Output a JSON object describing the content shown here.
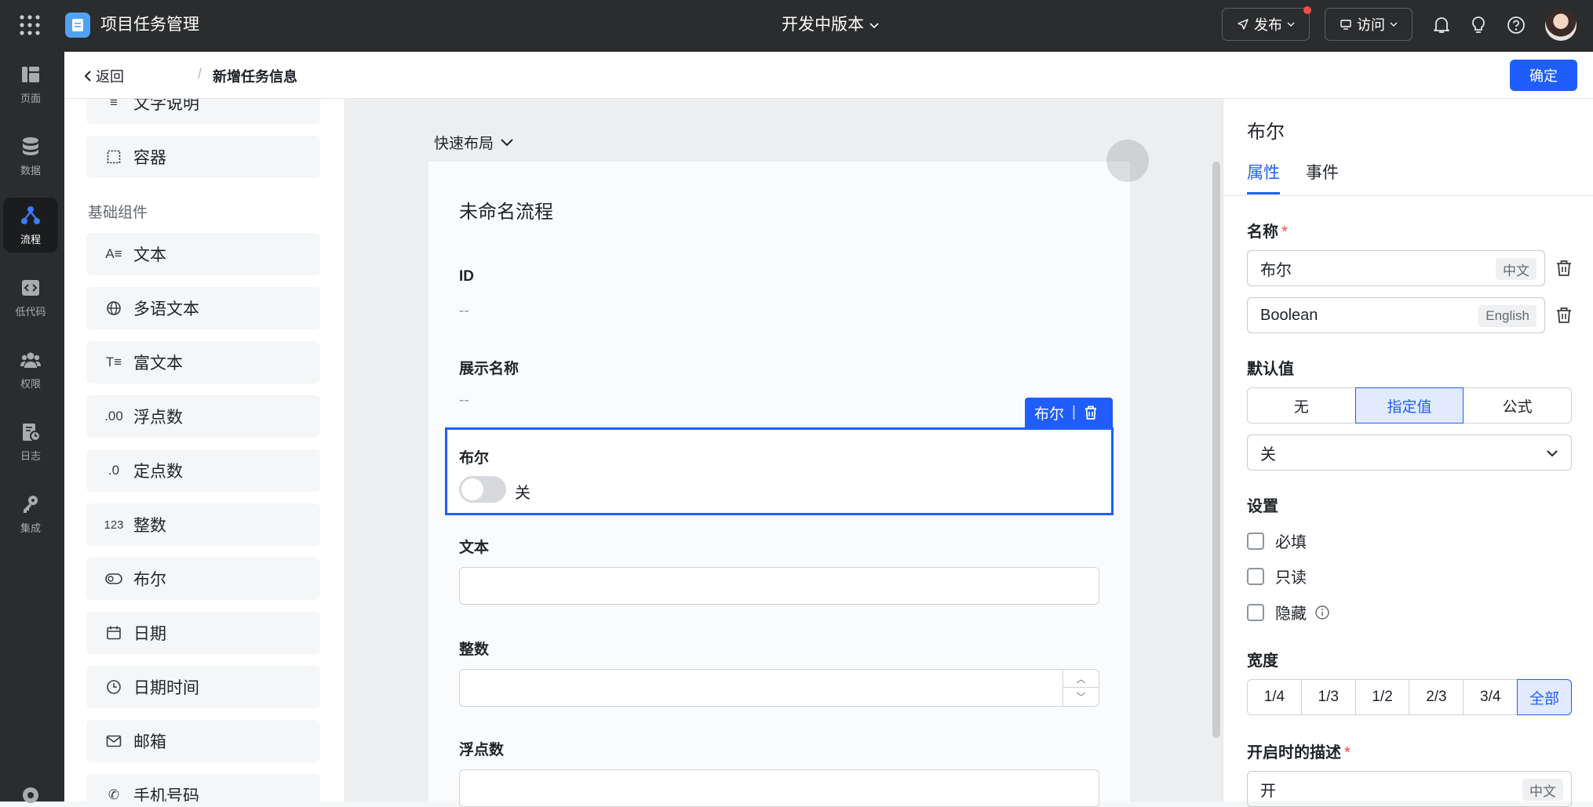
{
  "topbar": {
    "app_title": "项目任务管理",
    "version_label": "开发中版本",
    "publish_label": "发布",
    "visit_label": "访问"
  },
  "rail": {
    "items": [
      {
        "label": "页面",
        "icon": "pages-icon"
      },
      {
        "label": "数据",
        "icon": "database-icon"
      },
      {
        "label": "流程",
        "icon": "flow-icon",
        "active": true
      },
      {
        "label": "低代码",
        "icon": "code-icon"
      },
      {
        "label": "权限",
        "icon": "users-icon"
      },
      {
        "label": "日志",
        "icon": "log-icon"
      },
      {
        "label": "集成",
        "icon": "key-icon"
      }
    ]
  },
  "header": {
    "back_label": "返回",
    "separator": "/",
    "title": "新增任务信息",
    "confirm_label": "确定"
  },
  "components": {
    "top_items": [
      "文字说明",
      "容器"
    ],
    "section_label": "基础组件",
    "items": [
      {
        "label": "文本",
        "icon_text": "A≡"
      },
      {
        "label": "多语文本",
        "icon_text": "🌐"
      },
      {
        "label": "富文本",
        "icon_text": "T≡"
      },
      {
        "label": "浮点数",
        "icon_text": ".00"
      },
      {
        "label": "定点数",
        "icon_text": ".0"
      },
      {
        "label": "整数",
        "icon_text": "123"
      },
      {
        "label": "布尔",
        "icon_text": "⊙"
      },
      {
        "label": "日期",
        "icon_text": "▦"
      },
      {
        "label": "日期时间",
        "icon_text": "◷"
      },
      {
        "label": "邮箱",
        "icon_text": "✉"
      },
      {
        "label": "手机号码",
        "icon_text": "✆"
      }
    ]
  },
  "canvas": {
    "quick_layout": "快速布局",
    "form_title": "未命名流程",
    "id_label": "ID",
    "id_value": "--",
    "display_name_label": "展示名称",
    "display_name_value": "--",
    "selected_tag": "布尔",
    "bool_label": "布尔",
    "bool_value": "关",
    "text_label": "文本",
    "integer_label": "整数",
    "float_label": "浮点数"
  },
  "props": {
    "title": "布尔",
    "tab_attributes": "属性",
    "tab_events": "事件",
    "name_label": "名称",
    "required_mark": "*",
    "name_zh": "布尔",
    "lang_zh": "中文",
    "name_en": "Boolean",
    "lang_en": "English",
    "default_label": "默认值",
    "default_options": [
      "无",
      "指定值",
      "公式"
    ],
    "default_selected": "指定值",
    "default_value": "关",
    "settings_label": "设置",
    "setting_required": "必填",
    "setting_readonly": "只读",
    "setting_hidden": "隐藏",
    "width_label": "宽度",
    "width_options": [
      "1/4",
      "1/3",
      "1/2",
      "2/3",
      "3/4",
      "全部"
    ],
    "width_selected": "全部",
    "on_desc_label": "开启时的描述",
    "on_desc_value": "开",
    "on_desc_lang": "中文"
  },
  "colors": {
    "accent": "#1f5efc",
    "topbar": "#2b2c2e",
    "required": "#f54a45"
  }
}
